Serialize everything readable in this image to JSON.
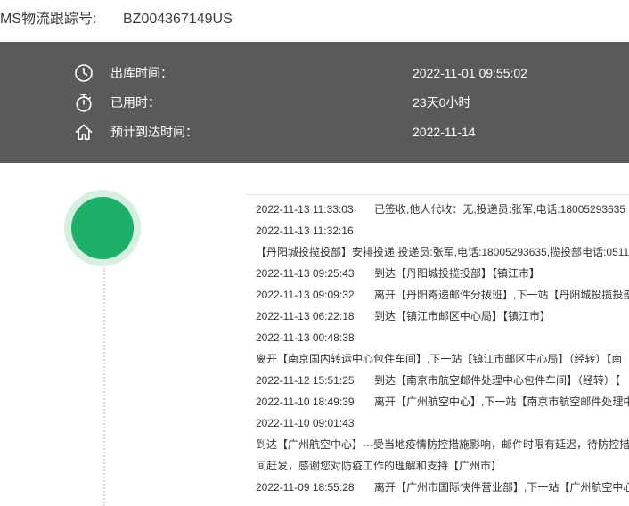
{
  "colors": {
    "info_band_bg": "#5a5a5a",
    "status_marker": "#1cb06b",
    "status_marker_ring": "#d6efe0",
    "text": "#333333"
  },
  "header": {
    "tracking_label": "MS物流跟踪号:",
    "tracking_number": "BZ004367149US"
  },
  "summary": {
    "ship_time": {
      "icon": "clock-icon",
      "label": "出库时间：",
      "value": "2022-11-01 09:55:02"
    },
    "elapsed": {
      "icon": "stopwatch-icon",
      "label": "已用时：",
      "value": "23天0小时"
    },
    "eta": {
      "icon": "home-icon",
      "label": "预计到达时间：",
      "value": "2022-11-14"
    }
  },
  "events": [
    {
      "time": "2022-11-13 11:33:03",
      "description": "已签收,他人代收：无,投递员:张军,电话:18005293635"
    },
    {
      "time": "2022-11-13 11:32:16"
    },
    {
      "description": "【丹阳城投揽投部】安排投递,投递员:张军,电话:18005293635,揽投部电话:0511"
    },
    {
      "time": "2022-11-13 09:25:43",
      "description": "到达【丹阳城投揽投部】【镇江市】"
    },
    {
      "time": "2022-11-13 09:09:32",
      "description": "离开【丹阳寄递邮件分拨班】,下一站【丹阳城投揽投部"
    },
    {
      "time": "2022-11-13 06:22:18",
      "description": "到达【镇江市邮区中心局】【镇江市】"
    },
    {
      "time": "2022-11-13 00:48:38"
    },
    {
      "description": "离开【南京国内转运中心包件车间】,下一站【镇江市邮区中心局】（经转）【南"
    },
    {
      "time": "2022-11-12 15:51:25",
      "description": "到达【南京市航空邮件处理中心包件车间】（经转）【"
    },
    {
      "time": "2022-11-10 18:49:39",
      "description": "离开【广州航空中心】,下一站【南京市航空邮件处理中"
    },
    {
      "time": "2022-11-10 09:01:43"
    },
    {
      "description": "到达【广州航空中心】---受当地疫情防控措施影响，邮件时限有延迟，待防控措"
    },
    {
      "description": "间赶发，感谢您对防疫工作的理解和支持【广州市】"
    },
    {
      "time": "2022-11-09 18:55:28",
      "description": "离开【广州市国际快件营业部】,下一站【广州航空中心"
    }
  ]
}
